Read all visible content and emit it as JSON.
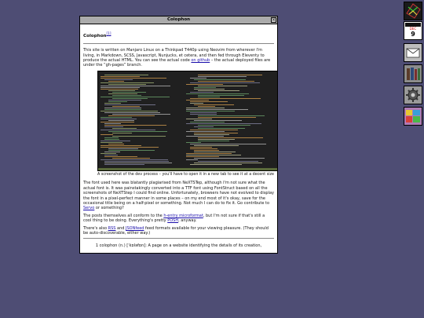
{
  "window": {
    "title": "Colophon",
    "close_glyph": "×"
  },
  "page": {
    "heading": "Colophon",
    "heading_ref": "[1]",
    "intro_1": "This site is written on Manjaro Linux on a Thinkpad T440p using Neovim from wherever I'm living, in Markdown, SCSS, Javascript, Nunjucks, et cetera, and then fed through Eleventy to produce the actual HTML. You can see the actual code ",
    "intro_link": "on github",
    "intro_2": " – the actual deployed files are under the “gh-pages” branch.",
    "caption": "A screenshot of the dev process – you'll have to open it in a new tab to see it at a decent size",
    "font_1": "The font used here was blatantly plagiarised from NeXTSTep, although I'm not sure what the actual font is. It was painstakingly converted into a TTF font using FontStruct based on all the screenshots of NeXTStep I could find online. Unfortunately, browsers have not evolved to display the font in a pixel-perfect manner in some places – on my end most of it's okay, save for the occasional title being on a half-pixel or something. Not much I can do to fix it. Go contribute to ",
    "font_link": "Servo",
    "font_2": " or something?",
    "posts_1": "The posts themselves all conform to the ",
    "posts_link1": "h-entry microformat",
    "posts_2": ", but I'm not sure if that's still a cool thing to be doing. Everything's pretty ",
    "posts_link2": "POSH",
    "posts_3": ", anyway.",
    "feeds_1": "There's also ",
    "feeds_link1": "RSS",
    "feeds_2": " and ",
    "feeds_link2": "JSONfeed",
    "feeds_3": " feed formats available for your viewing pleasure. (They should be auto-discoverable, either way.)",
    "footnote": "1 colophon (n.) [ˈkɒləfɒn]: A page on a website identifying the details of its creation,"
  },
  "dock": {
    "items": [
      {
        "icon": "nextstep-logo-icon",
        "bg": "#1a1a1a"
      },
      {
        "icon": "clock-calendar-icon",
        "day": "9",
        "month": "DEC",
        "bg": "#ffffff"
      },
      {
        "icon": "mail-icon",
        "bg": "#bdbdbd"
      },
      {
        "icon": "books-icon",
        "bg": "#8c8c8c"
      },
      {
        "icon": "preferences-gear-icon",
        "bg": "#9a9a9a"
      },
      {
        "icon": "color-palette-icon",
        "bg": "#b07ab5"
      }
    ]
  },
  "colors": {
    "desktop": "#4e4d74",
    "link": "#1a0dab"
  }
}
